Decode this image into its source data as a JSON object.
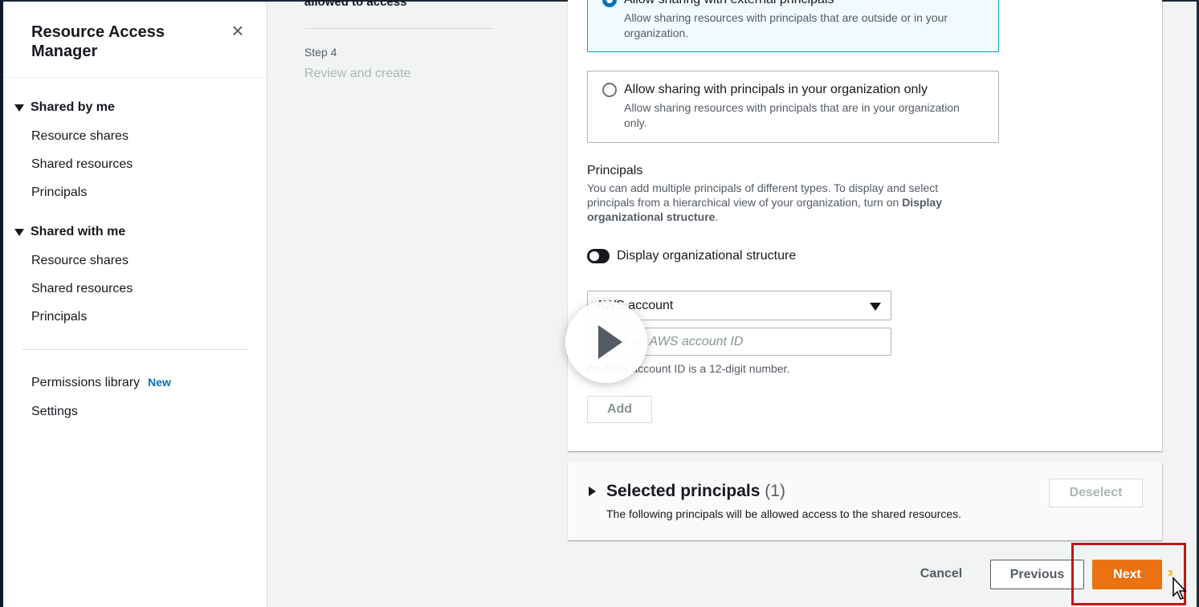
{
  "sidebar": {
    "title": "Resource Access Manager",
    "close_icon": "close-icon",
    "sections": [
      {
        "label": "Shared by me",
        "items": [
          "Resource shares",
          "Shared resources",
          "Principals"
        ]
      },
      {
        "label": "Shared with me",
        "items": [
          "Resource shares",
          "Shared resources",
          "Principals"
        ]
      }
    ],
    "footer_links": [
      {
        "label": "Permissions library",
        "badge": "New"
      },
      {
        "label": "Settings"
      }
    ]
  },
  "steps": {
    "previous_step_tail": "allowed to access",
    "step_number": "Step 4",
    "step_name": "Review and create"
  },
  "sharing_options": {
    "external": {
      "label": "Allow sharing with external principals",
      "description": "Allow sharing resources with principals that are outside or in your organization.",
      "selected": true
    },
    "org_only": {
      "label": "Allow sharing with principals in your organization only",
      "description": "Allow sharing resources with principals that are in your organization only.",
      "selected": false
    }
  },
  "principals": {
    "title": "Principals",
    "description_start": "You can add multiple principals of different types. To display and select principals from a hierarchical view of your organization, turn on ",
    "description_bold": "Display organizational structure",
    "description_end": ".",
    "toggle_label": "Display organizational structure",
    "toggle_on": false,
    "type_select_value": "AWS account",
    "account_input_placeholder": "Enter an AWS account ID",
    "account_input_value": "",
    "hint": "An AWS account ID is a 12-digit number.",
    "add_label": "Add"
  },
  "selected_principals": {
    "title": "Selected principals",
    "count": "(1)",
    "description": "The following principals will be allowed access to the shared resources.",
    "deselect_label": "Deselect"
  },
  "footer": {
    "cancel_label": "Cancel",
    "previous_label": "Previous",
    "next_label": "Next"
  },
  "colors": {
    "accent_orange": "#ec7211",
    "selection_blue": "#0073bb",
    "highlight_red": "#c0161b"
  }
}
